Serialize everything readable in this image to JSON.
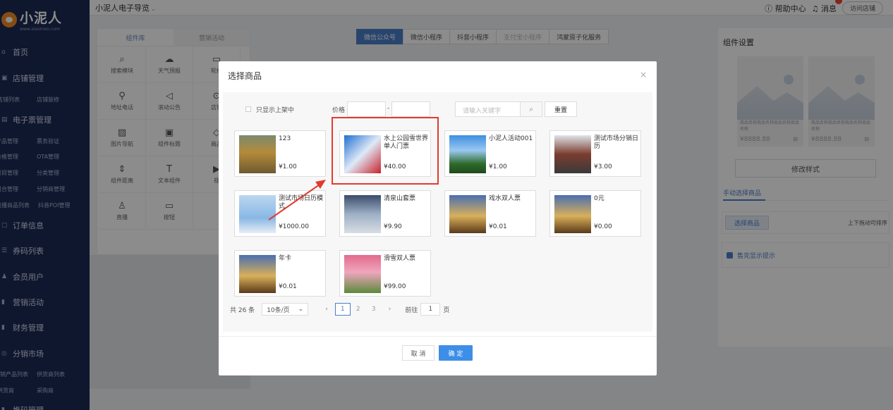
{
  "app": {
    "logo_title": "小泥人",
    "logo_sub": "www.xiaonren.com",
    "title": "小泥人电子导览",
    "help": "帮助中心",
    "messages": "消息",
    "visit_store": "访问店铺"
  },
  "sidebar": {
    "home": "首页",
    "store_mgmt": "店铺管理",
    "store_list": "店铺列表",
    "store_decor": "店铺装修",
    "eticket_mgmt": "电子票管理",
    "product_mgmt": "产品管理",
    "ticket_verify": "票务验证",
    "price_mgmt": "价格管理",
    "ota_mgmt": "OTA管理",
    "item_mgmt": "项目管理",
    "category_mgmt": "分类管理",
    "combo_mgmt": "组合管理",
    "distributor_mgmt": "分销商管理",
    "live_list": "直播商品列表",
    "douyin_poi": "抖音POI管理",
    "order_info": "订单信息",
    "coupon_list": "券码列表",
    "members": "会员用户",
    "marketing": "营销活动",
    "finance": "财务管理",
    "distribution_market": "分销市场",
    "dist_products": "分销产品列表",
    "supply_products": "供货商列表",
    "supplier": "供货商",
    "purchaser": "采购商",
    "more": "推码管理"
  },
  "library": {
    "tab_components": "组件库",
    "tab_marketing": "营销活动",
    "items": [
      "搜索模块",
      "天气预报",
      "轮播",
      "地址电话",
      "滚动公告",
      "店铺",
      "图片导航",
      "组件标题",
      "商品",
      "组件距离",
      "文本组件",
      "视",
      "直播",
      "按钮",
      ""
    ]
  },
  "platform_tabs": [
    "微信公众号",
    "微信小程序",
    "抖音小程序",
    "支付宝小程序",
    "鸿蒙原子化服务"
  ],
  "settings": {
    "title": "组件设置",
    "card_name": "商品名称商品名称商品名称商品名称",
    "card_price": "¥8888.88",
    "modify_style": "修改样式",
    "manual_select": "手动选择商品",
    "select_goods": "选择商品",
    "sort_hint": "上下拖动可排序",
    "soldout_hint": "售完显示提示"
  },
  "modal": {
    "title": "选择商品",
    "close": "×",
    "only_listed": "只显示上架中",
    "price_label": "价格",
    "price_dash": "-",
    "keyword_placeholder": "请输入关键字",
    "reset": "重置",
    "goods": [
      {
        "name": "123",
        "price": "¥1.00"
      },
      {
        "name": "水上公园雪世界单人门票",
        "price": "¥40.00"
      },
      {
        "name": "小泥人活动001",
        "price": "¥1.00"
      },
      {
        "name": "测试市场分销日历",
        "price": "¥3.00"
      },
      {
        "name": "测试市场日历模式",
        "price": "¥1000.00"
      },
      {
        "name": "清泉山套票",
        "price": "¥9.90"
      },
      {
        "name": "戏水双人票",
        "price": "¥0.01"
      },
      {
        "name": "0元",
        "price": "¥0.00"
      },
      {
        "name": "年卡",
        "price": "¥0.01"
      },
      {
        "name": "滑雪双人票",
        "price": "¥99.00"
      }
    ],
    "pager": {
      "total": "共 26 条",
      "page_size": "10条/页",
      "pages": [
        "1",
        "2",
        "3"
      ],
      "goto": "前往",
      "goto_value": "1",
      "page_unit": "页"
    },
    "cancel": "取 消",
    "confirm": "确 定"
  },
  "colors": {
    "sidebar_bg": "#1c2a55",
    "accent": "#3d8ee8",
    "highlight": "#e23b2e"
  }
}
